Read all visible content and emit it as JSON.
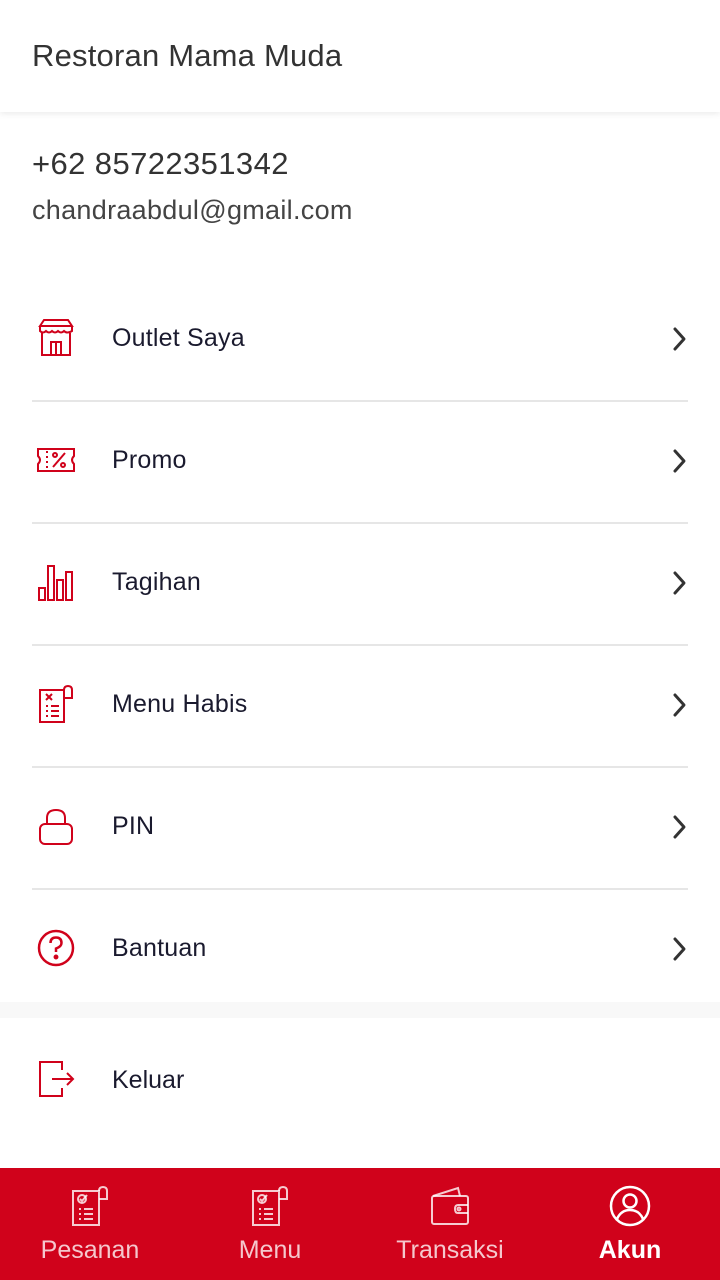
{
  "header": {
    "title": "Restoran Mama Muda"
  },
  "profile": {
    "phone": "+62 85722351342",
    "email": "chandraabdul@gmail.com"
  },
  "menu": {
    "items": [
      {
        "label": "Outlet Saya",
        "icon": "store-icon"
      },
      {
        "label": "Promo",
        "icon": "voucher-percent-icon"
      },
      {
        "label": "Tagihan",
        "icon": "bar-chart-icon"
      },
      {
        "label": "Menu Habis",
        "icon": "menu-receipt-icon"
      },
      {
        "label": "PIN",
        "icon": "lock-icon"
      },
      {
        "label": "Bantuan",
        "icon": "help-circle-icon"
      }
    ],
    "logout_label": "Keluar"
  },
  "bottom_nav": {
    "items": [
      {
        "label": "Pesanan",
        "icon": "order-receipt-icon",
        "active": false
      },
      {
        "label": "Menu",
        "icon": "menu-receipt-icon",
        "active": false
      },
      {
        "label": "Transaksi",
        "icon": "wallet-icon",
        "active": false
      },
      {
        "label": "Akun",
        "icon": "user-circle-icon",
        "active": true
      }
    ]
  },
  "colors": {
    "accent": "#d0021b",
    "text_primary": "#1a1a2e",
    "divider": "#e6e6e6"
  }
}
